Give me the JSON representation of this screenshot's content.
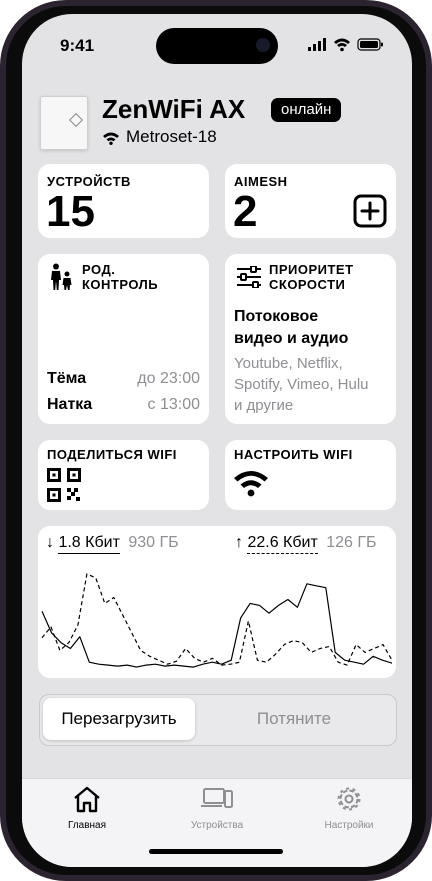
{
  "status_bar": {
    "time": "9:41"
  },
  "device": {
    "name": "ZenWiFi AX",
    "state_badge": "онлайн",
    "network": "Metroset-18"
  },
  "cards": {
    "devices": {
      "label": "УСТРОЙСТВ",
      "count": "15"
    },
    "aimesh": {
      "label": "AIMESH",
      "count": "2",
      "add_icon": "plus-square-icon"
    },
    "parental": {
      "label_line1": "РОД.",
      "label_line2": "КОНТРОЛЬ",
      "icon": "family-icon",
      "rows": [
        {
          "name": "Тёма",
          "time": "до 23:00"
        },
        {
          "name": "Натка",
          "time": "с 13:00"
        }
      ]
    },
    "priority": {
      "label_line1": "ПРИОРИТЕТ",
      "label_line2": "СКОРОСТИ",
      "icon": "sliders-icon",
      "desc_line1": "Потоковое",
      "desc_line2": "видео и аудио",
      "apps_line1": "Youtube, Netflix,",
      "apps_line2": "Spotify, Vimeo, Hulu",
      "apps_line3": "и другие"
    },
    "share_wifi": {
      "label": "ПОДЕЛИТЬСЯ WIFI",
      "icon": "qr-code-icon"
    },
    "setup_wifi": {
      "label": "НАСТРОИТЬ WIFI",
      "icon": "wifi-icon"
    }
  },
  "traffic": {
    "download": {
      "arrow": "↓",
      "speed": "1.8 Кбит",
      "total": "930 ГБ"
    },
    "upload": {
      "arrow": "↑",
      "speed": "22.6 Кбит",
      "total": "126 ГБ"
    },
    "series": [
      {
        "name": "download",
        "style": "solid",
        "values": [
          62,
          40,
          30,
          24,
          36,
          10,
          8,
          7,
          6,
          7,
          5,
          7,
          8,
          6,
          7,
          6,
          5,
          8,
          10,
          8,
          12,
          55,
          70,
          68,
          60,
          68,
          74,
          66,
          90,
          88,
          86,
          20,
          12,
          10,
          8,
          16,
          12,
          9
        ]
      },
      {
        "name": "upload",
        "style": "dashed",
        "values": [
          35,
          46,
          22,
          30,
          48,
          100,
          96,
          70,
          76,
          58,
          40,
          22,
          16,
          12,
          8,
          11,
          24,
          14,
          10,
          14,
          7,
          8,
          10,
          52,
          12,
          10,
          18,
          28,
          32,
          30,
          20,
          24,
          26,
          10,
          7,
          28,
          20,
          24,
          28,
          12
        ]
      }
    ]
  },
  "controls": {
    "reboot": "Перезагрузить",
    "pull": "Потяните"
  },
  "tabbar": [
    {
      "label": "Главная",
      "icon": "home-icon",
      "active": true
    },
    {
      "label": "Устройства",
      "icon": "devices-icon",
      "active": false
    },
    {
      "label": "Настройки",
      "icon": "gear-icon",
      "active": false
    }
  ],
  "colors": {
    "accent": "#000000",
    "muted": "#8e8e93",
    "screen_bg": "#e3e3e6",
    "card_bg": "#ffffff"
  }
}
